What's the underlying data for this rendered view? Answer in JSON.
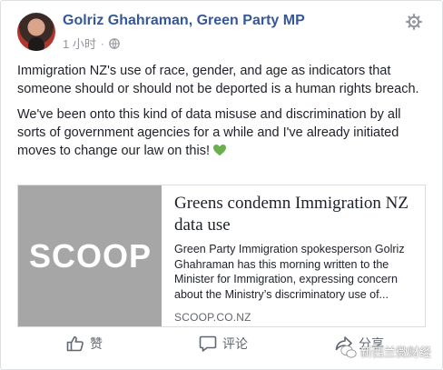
{
  "post": {
    "author": "Golriz Ghahraman, Green Party MP",
    "timestamp": "1 小时",
    "privacy_icon": "globe-icon",
    "more_icon": "gear-icon",
    "paragraphs": [
      "Immigration NZ's use of race, gender, and age as indicators that someone should or should not be deported is a human rights breach.",
      "We've been onto this kind of data misuse and discrimination by all sorts of government agencies for a while and I've already initiated moves to change our law on this!"
    ],
    "emoji": "green-heart-icon"
  },
  "link_card": {
    "thumbnail_text": "SCOOP",
    "title": "Greens condemn Immigration NZ data use",
    "description": "Green Party Immigration spokesperson Golriz Ghahraman has this morning written to the Minister for Immigration, expressing concern about the Ministry’s discriminatory use of...",
    "domain": "SCOOP.CO.NZ"
  },
  "actions": {
    "like_label": "赞",
    "comment_label": "评论",
    "share_label": "分享"
  },
  "watermark": {
    "text": "新西兰微财经"
  },
  "colors": {
    "author": "#365899",
    "meta": "#90949c",
    "body": "#1d2129",
    "thumb_bg": "#a6a6a6",
    "heart": "#6ab04c"
  }
}
